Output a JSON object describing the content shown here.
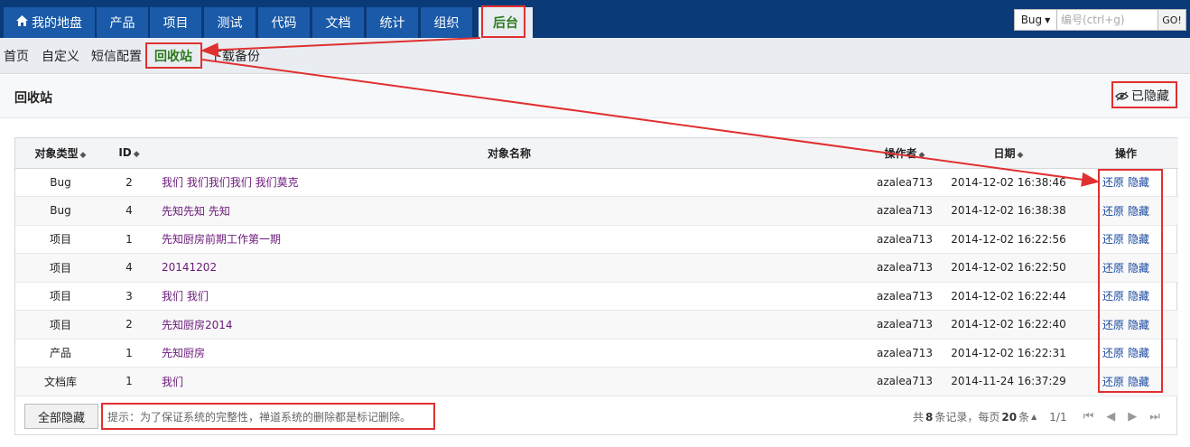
{
  "nav": {
    "tabs": [
      {
        "label": "我的地盘",
        "icon": "home-icon"
      },
      {
        "label": "产品"
      },
      {
        "label": "项目"
      },
      {
        "label": "测试"
      },
      {
        "label": "代码"
      },
      {
        "label": "文档"
      },
      {
        "label": "统计"
      },
      {
        "label": "组织"
      },
      {
        "label": "后台",
        "active": true
      }
    ]
  },
  "search": {
    "select_value": "Bug",
    "placeholder": "编号(ctrl+g)",
    "go_label": "GO!"
  },
  "subnav": {
    "items": [
      {
        "label": "首页"
      },
      {
        "label": "自定义"
      },
      {
        "label": "短信配置"
      },
      {
        "label": "回收站",
        "active": true
      },
      {
        "label": "下载备份"
      }
    ]
  },
  "page": {
    "title": "回收站",
    "hidden_toggle_label": "已隐藏"
  },
  "table": {
    "columns": [
      "对象类型",
      "ID",
      "对象名称",
      "操作者",
      "日期",
      "操作"
    ],
    "rows": [
      {
        "type": "Bug",
        "id": "2",
        "name": "我们 我们我们我们 我们莫克",
        "actor": "azalea713",
        "date": "2014-12-02 16:38:46"
      },
      {
        "type": "Bug",
        "id": "4",
        "name": "先知先知 先知",
        "actor": "azalea713",
        "date": "2014-12-02 16:38:38"
      },
      {
        "type": "项目",
        "id": "1",
        "name": "先知厨房前期工作第一期",
        "actor": "azalea713",
        "date": "2014-12-02 16:22:56"
      },
      {
        "type": "项目",
        "id": "4",
        "name": "20141202",
        "actor": "azalea713",
        "date": "2014-12-02 16:22:50"
      },
      {
        "type": "项目",
        "id": "3",
        "name": "我们 我们",
        "actor": "azalea713",
        "date": "2014-12-02 16:22:44"
      },
      {
        "type": "项目",
        "id": "2",
        "name": "先知厨房2014",
        "actor": "azalea713",
        "date": "2014-12-02 16:22:40"
      },
      {
        "type": "产品",
        "id": "1",
        "name": "先知厨房",
        "actor": "azalea713",
        "date": "2014-12-02 16:22:31"
      },
      {
        "type": "文档库",
        "id": "1",
        "name": "我们",
        "actor": "azalea713",
        "date": "2014-11-24 16:37:29"
      }
    ],
    "restore_label": "还原",
    "hide_label": "隐藏"
  },
  "footer": {
    "hide_all_label": "全部隐藏",
    "hint": "提示：为了保证系统的完整性，禅道系统的删除都是标记删除。",
    "pager_prefix": "共",
    "pager_total": "8",
    "pager_mid": "条记录，每页",
    "pager_per_page": "20",
    "pager_suffix": "条",
    "pager_page": "1/1"
  },
  "colors": {
    "nav_bg": "#0a3a78",
    "tab_bg": "#1a5aa8",
    "active_green": "#2a7a1a",
    "link_purple": "#6b1a7a",
    "link_blue": "#1a4aa0",
    "annotation_red": "#e03030"
  }
}
